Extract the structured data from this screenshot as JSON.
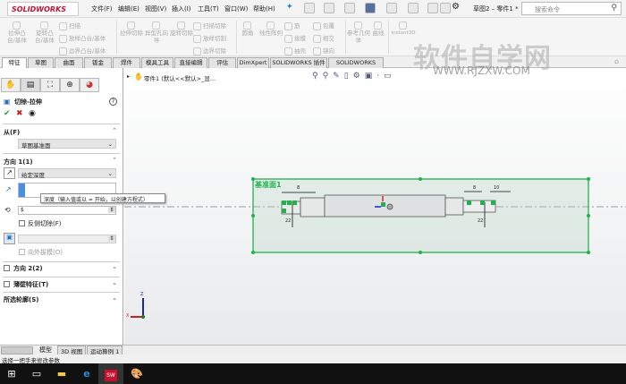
{
  "app": {
    "logo": "SOLIDWORKS",
    "document_title": "草图2 – 零件1 *",
    "search_placeholder": "搜索命令"
  },
  "menu": [
    "文件(F)",
    "编辑(E)",
    "视图(V)",
    "插入(I)",
    "工具(T)",
    "窗口(W)",
    "帮助(H)"
  ],
  "ribbon": {
    "big": [
      "拉伸凸台/基体",
      "旋转凸台/基体",
      "拉伸切除",
      "异型孔向导",
      "旋转切除",
      "圆角",
      "线性阵列",
      "参考几何体",
      "曲线",
      "Instant3D"
    ],
    "small": [
      "扫描",
      "放样凸台/基体",
      "边界凸台/基体",
      "扫描切除",
      "放样切割",
      "边界切除",
      "筋",
      "拔模",
      "抽壳",
      "包覆",
      "相交",
      "镜向"
    ]
  },
  "tabs": [
    "特征",
    "草图",
    "曲面",
    "钣金",
    "焊件",
    "模具工具",
    "直接编辑",
    "评估",
    "DimXpert",
    "SOLIDWORKS 插件",
    "SOLIDWORKS MBD"
  ],
  "tree": {
    "root": "零件1 (默认<<默认>_显..."
  },
  "panel": {
    "title": "切除-拉伸",
    "help": "?",
    "from": {
      "label": "从(F)",
      "value": "草图基准面"
    },
    "dir1": {
      "label": "方向 1(1)",
      "type": "给定深度",
      "depth": "",
      "draft_value": "$",
      "flip_label": "反侧切除(F)",
      "draft_out_label": "向外拔模(O)"
    },
    "tooltip": "深度（输入值或以 = 开始，以创建方程式）",
    "dir2": "方向 2(2)",
    "thin": "薄壁特征(T)",
    "contours": "所选轮廓(S)"
  },
  "viewport": {
    "plane_label": "基准面1",
    "dims": [
      "8",
      "8",
      "10",
      "22",
      "22"
    ],
    "triad": {
      "z": "Z",
      "x": "X"
    }
  },
  "watermark": {
    "text": "软件自学网",
    "url": "WWW.RJZXW.COM"
  },
  "bottom_tabs": [
    "模型",
    "3D 视图",
    "运动算例 1"
  ],
  "status": "选择一把手来修改参数",
  "colors": {
    "accent": "#22b14c",
    "brand": "#c8102e"
  }
}
